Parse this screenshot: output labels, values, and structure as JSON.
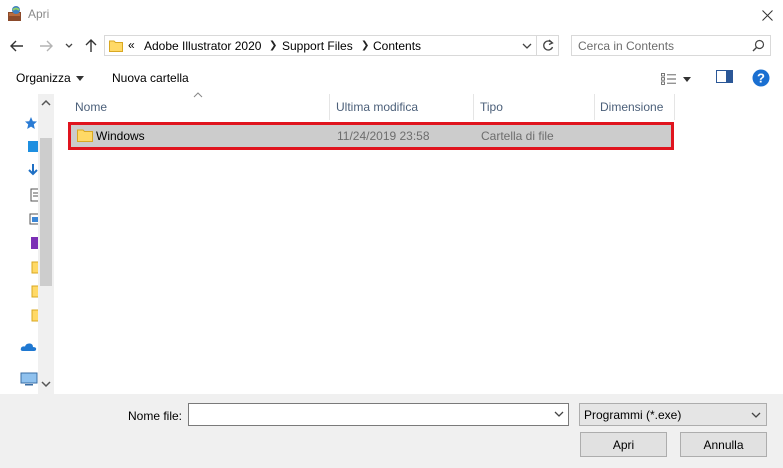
{
  "window": {
    "title": "Apri"
  },
  "address": {
    "overflow": "«",
    "crumbs": [
      "Adobe Illustrator 2020",
      "Support Files",
      "Contents"
    ]
  },
  "search": {
    "placeholder": "Cerca in Contents"
  },
  "toolbar": {
    "organize_label": "Organizza",
    "new_folder_label": "Nuova cartella"
  },
  "columns": [
    "Nome",
    "Ultima modifica",
    "Tipo",
    "Dimensione"
  ],
  "rows": [
    {
      "name": "Windows",
      "modified": "11/24/2019 23:58",
      "type": "Cartella di file",
      "size": ""
    }
  ],
  "footer": {
    "filename_label": "Nome file:",
    "filename_value": "",
    "filetype_selected": "Programmi (*.exe)",
    "open_label": "Apri",
    "cancel_label": "Annulla"
  },
  "colors": {
    "selection_bg": "#cccccc",
    "highlight_outline": "#e0141e",
    "header_text": "#4c607a",
    "help_blue": "#1a6fd1"
  },
  "icons": [
    "app-icon",
    "close-icon",
    "back-arrow-icon",
    "forward-arrow-icon",
    "chevron-down-icon",
    "up-arrow-icon",
    "folder-icon",
    "refresh-icon",
    "search-icon",
    "view-icon",
    "preview-pane-icon",
    "help-icon",
    "quick-access-icon",
    "onedrive-icon",
    "this-pc-icon"
  ]
}
